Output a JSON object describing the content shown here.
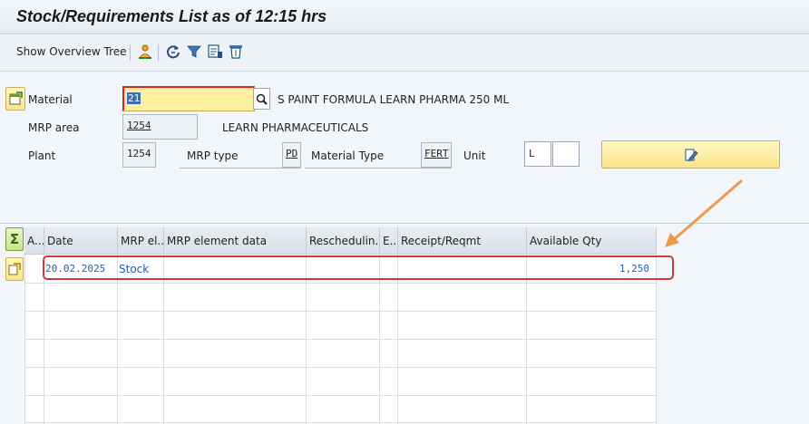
{
  "window": {
    "title": "Stock/Requirements List as of 12:15 hrs"
  },
  "toolbar": {
    "show_overview_tree": "Show Overview Tree",
    "icons": [
      "person-orange-icon",
      "refresh-icon",
      "filter-icon",
      "layout-icon",
      "trash-filter-icon"
    ]
  },
  "header": {
    "material": {
      "label": "Material",
      "value": "21",
      "description": "S PAINT FORMULA LEARN PHARMA 250 ML"
    },
    "mrp_area": {
      "label": "MRP area",
      "value": "1254",
      "description": "LEARN PHARMACEUTICALS"
    },
    "plant": {
      "label": "Plant",
      "value": "1254"
    },
    "mrp_type": {
      "label": "MRP type",
      "value": "PD"
    },
    "material_type": {
      "label": "Material Type",
      "value": "FERT"
    },
    "unit": {
      "label": "Unit",
      "value": "L"
    }
  },
  "grid": {
    "columns": [
      "A...",
      "Date",
      "MRP el...",
      "MRP element data",
      "Reschedulin...",
      "E..",
      "Receipt/Reqmt",
      "Available Qty"
    ],
    "rows": [
      {
        "date": "20.02.2025",
        "mrp_element": "Stock",
        "available_qty": "1,250"
      }
    ]
  },
  "colors": {
    "highlight": "#cc3a3a",
    "annotation_arrow": "#ee9a4d",
    "link_blue": "#1f5fa8"
  }
}
